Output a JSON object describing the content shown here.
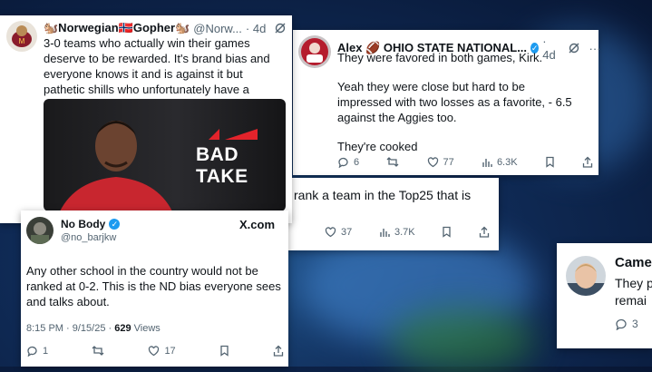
{
  "tweet_norwegian": {
    "name": "🐿️Norwegian🇳🇴Gopher🐿️",
    "handle": "@Norw...",
    "time": "· 4d",
    "text": "3-0 teams who actually win their games deserve to be rewarded. It's brand bias and everyone knows it and is against it but pathetic shills who unfortunately have a platform.",
    "media_caption": "BAD TAKE"
  },
  "tweet_alex": {
    "name": "Alex 🏈 OHIO STATE NATIONAL...",
    "time": "· 4d",
    "p1": "They were favored in both games, Kirk.",
    "p2": "Yeah they were close but hard to be impressed with two losses as a favorite, - 6.5 against the Aggies too.",
    "p3": "They're cooked",
    "replies": "6",
    "likes": "77",
    "views": "6.3K"
  },
  "tweet_top25": {
    "text": "rank a team in the Top25 that is",
    "likes": "37",
    "views": "3.7K"
  },
  "tweet_nobody": {
    "name": "No Body",
    "handle": "@no_barjkw",
    "site": "X.com",
    "text": "Any other school in the country would not be ranked at 0-2. This is the ND bias everyone sees and talks about.",
    "time": "8:15 PM · 9/15/25 · ",
    "views_count": "629",
    "views_label": " Views",
    "replies": "1",
    "likes": "17"
  },
  "tweet_came": {
    "name": "Came",
    "line1": "They p",
    "line2": "remai",
    "replies": "3"
  },
  "colors": {
    "accent": "#1d9bf0",
    "bad_take_red": "#e3232b"
  }
}
